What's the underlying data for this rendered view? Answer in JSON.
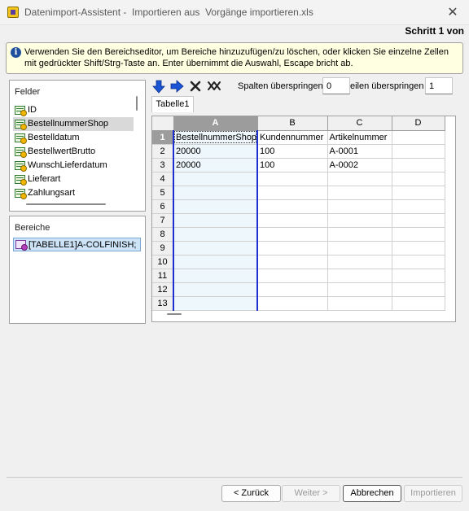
{
  "window": {
    "title": "Datenimport-Assistent -  Importieren aus  Vorgänge importieren.xls",
    "step": "Schritt 1 von"
  },
  "info": {
    "icon": "info-icon",
    "text": "Verwenden Sie den Bereichseditor, um Bereiche hinzuzufügen/zu löschen, oder klicken Sie einzelne Zellen mit gedrückter Shift/Strg-Taste an. Enter übernimmt die Auswahl, Escape bricht ab."
  },
  "fields": {
    "label": "Felder",
    "items": [
      "ID",
      "BestellnummerShop",
      "Bestelldatum",
      "BestellwertBrutto",
      "WunschLieferdatum",
      "Lieferart",
      "Zahlungsart"
    ],
    "selected_index": 1
  },
  "areas": {
    "label": "Bereiche",
    "items": [
      "[TABELLE1]A-COLFINISH;"
    ]
  },
  "toolbar": {
    "icons": [
      "arrow-down-icon",
      "arrow-right-icon",
      "delete-icon",
      "delete-all-icon"
    ],
    "skip_cols_label": "Spalten überspringen",
    "skip_cols_value": "0",
    "skip_rows_label": "eilen überspringen",
    "skip_rows_value": "1"
  },
  "sheet": {
    "tab": "Tabelle1",
    "columns": [
      "A",
      "B",
      "C",
      "D"
    ],
    "selected_column": "A",
    "row_numbers": [
      "1",
      "2",
      "3",
      "4",
      "5",
      "6",
      "7",
      "8",
      "9",
      "10",
      "11",
      "12",
      "13"
    ],
    "rows": [
      [
        "BestellnummerShop",
        "Kundennummer",
        "Artikelnummer",
        ""
      ],
      [
        "20000",
        "100",
        "A-0001",
        ""
      ],
      [
        "20000",
        "100",
        "A-0002",
        ""
      ]
    ]
  },
  "buttons": {
    "back": "< Zurück",
    "next": "Weiter >",
    "cancel": "Abbrechen",
    "import": "Importieren"
  },
  "colors": {
    "selection_border": "#1c2fd0",
    "info_background": "#ffffe1",
    "selected_area": "#cde3f7"
  }
}
